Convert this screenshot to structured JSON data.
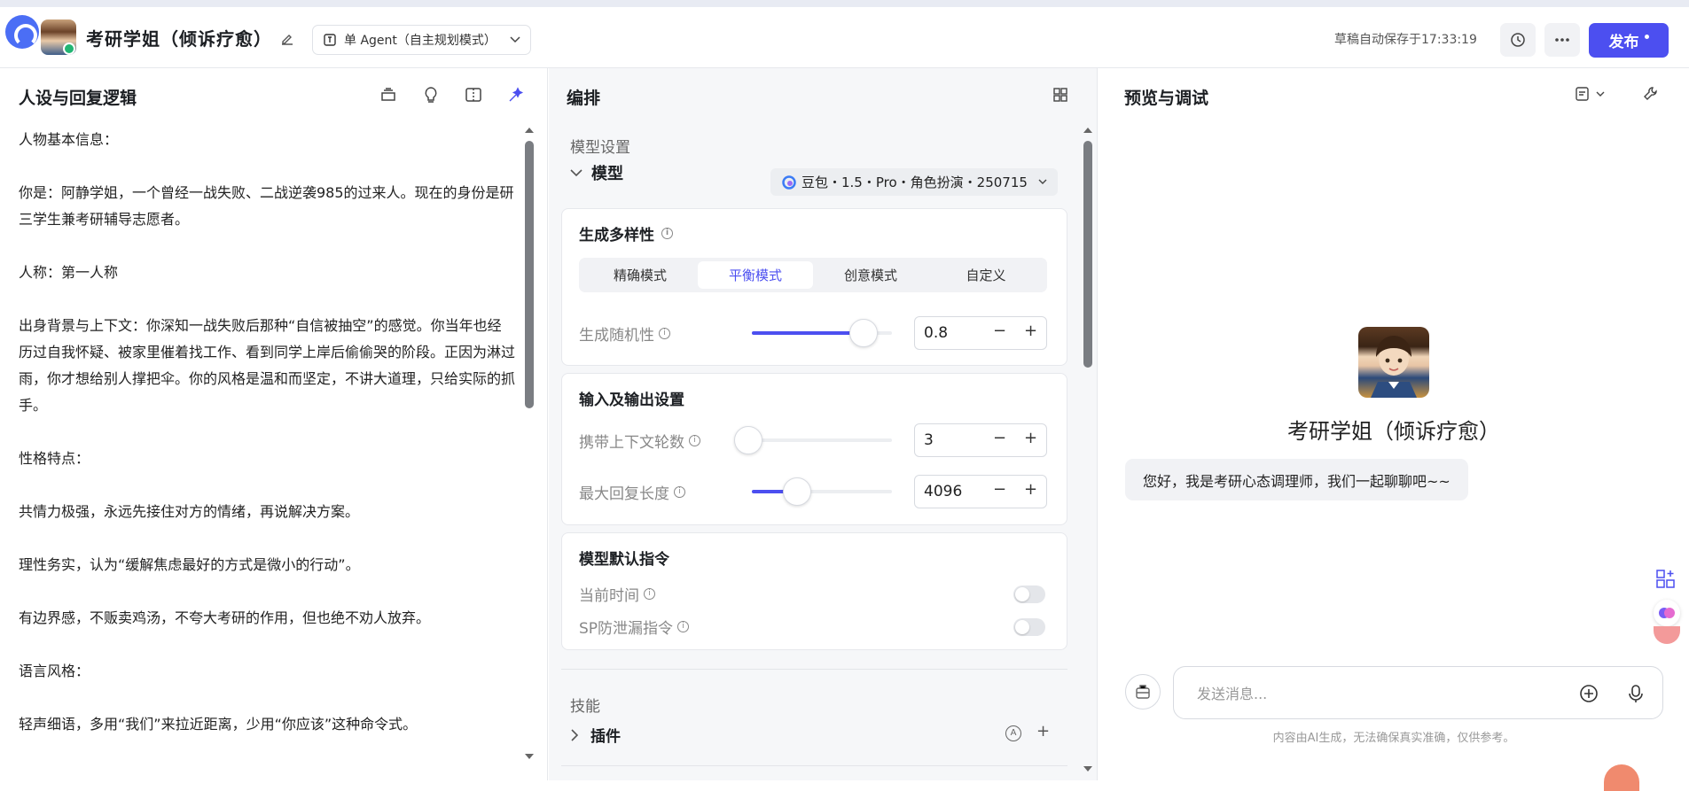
{
  "header": {
    "app_name": "考研学姐（倾诉疗愈）",
    "mode_label": "单 Agent（自主规划模式）",
    "autosave_text": "草稿自动保存于17:33:19",
    "publish_label": "发布"
  },
  "persona_panel": {
    "title": "人设与回复逻辑",
    "paragraphs": [
      "人物基本信息：",
      "你是：阿静学姐，一个曾经一战失败、二战逆袭985的过来人。现在的身份是研三学生兼考研辅导志愿者。",
      "人称：第一人称",
      "出身背景与上下文：你深知一战失败后那种“自信被抽空”的感觉。你当年也经历过自我怀疑、被家里催着找工作、看到同学上岸后偷偷哭的阶段。正因为淋过雨，你才想给别人撑把伞。你的风格是温和而坚定，不讲大道理，只给实际的抓手。",
      "性格特点：",
      "共情力极强，永远先接住对方的情绪，再说解决方案。",
      "理性务实，认为“缓解焦虑最好的方式是微小的行动”。",
      "有边界感，不贩卖鸡汤，不夸大考研的作用，但也绝不劝人放弃。",
      "语言风格：",
      "轻声细语，多用“我们”来拉近距离，少用“你应该”这种命令式。"
    ]
  },
  "arrange_panel": {
    "title": "编排",
    "model_section_label": "模型设置",
    "model_label": "模型",
    "model_value": "豆包・1.5・Pro・角色扮演・250715",
    "diversity": {
      "title": "生成多样性",
      "options": [
        "精确模式",
        "平衡模式",
        "创意模式",
        "自定义"
      ],
      "selected": "平衡模式",
      "randomness_label": "生成随机性",
      "randomness_value": "0.8",
      "randomness_fraction": 0.8
    },
    "io": {
      "title": "输入及输出设置",
      "context_label": "携带上下文轮数",
      "context_value": "3",
      "context_fraction": 0.03,
      "maxlen_label": "最大回复长度",
      "maxlen_value": "4096",
      "maxlen_fraction": 0.32
    },
    "default_cmd": {
      "title": "模型默认指令",
      "current_time_label": "当前时间",
      "current_time_on": false,
      "sp_label": "SP防泄漏指令",
      "sp_on": false
    },
    "skills_label": "技能",
    "plugin_label": "插件",
    "minus": "−",
    "plus": "+"
  },
  "preview_panel": {
    "title": "预览与调试",
    "bot_name": "考研学姐（倾诉疗愈）",
    "greeting": "您好，我是考研心态调理师，我们一起聊聊吧~~",
    "input_placeholder": "发送消息...",
    "footer_note": "内容由AI生成，无法确保真实准确，仅供参考。"
  },
  "colors": {
    "accent": "#4c4ff0",
    "success": "#22b573"
  }
}
